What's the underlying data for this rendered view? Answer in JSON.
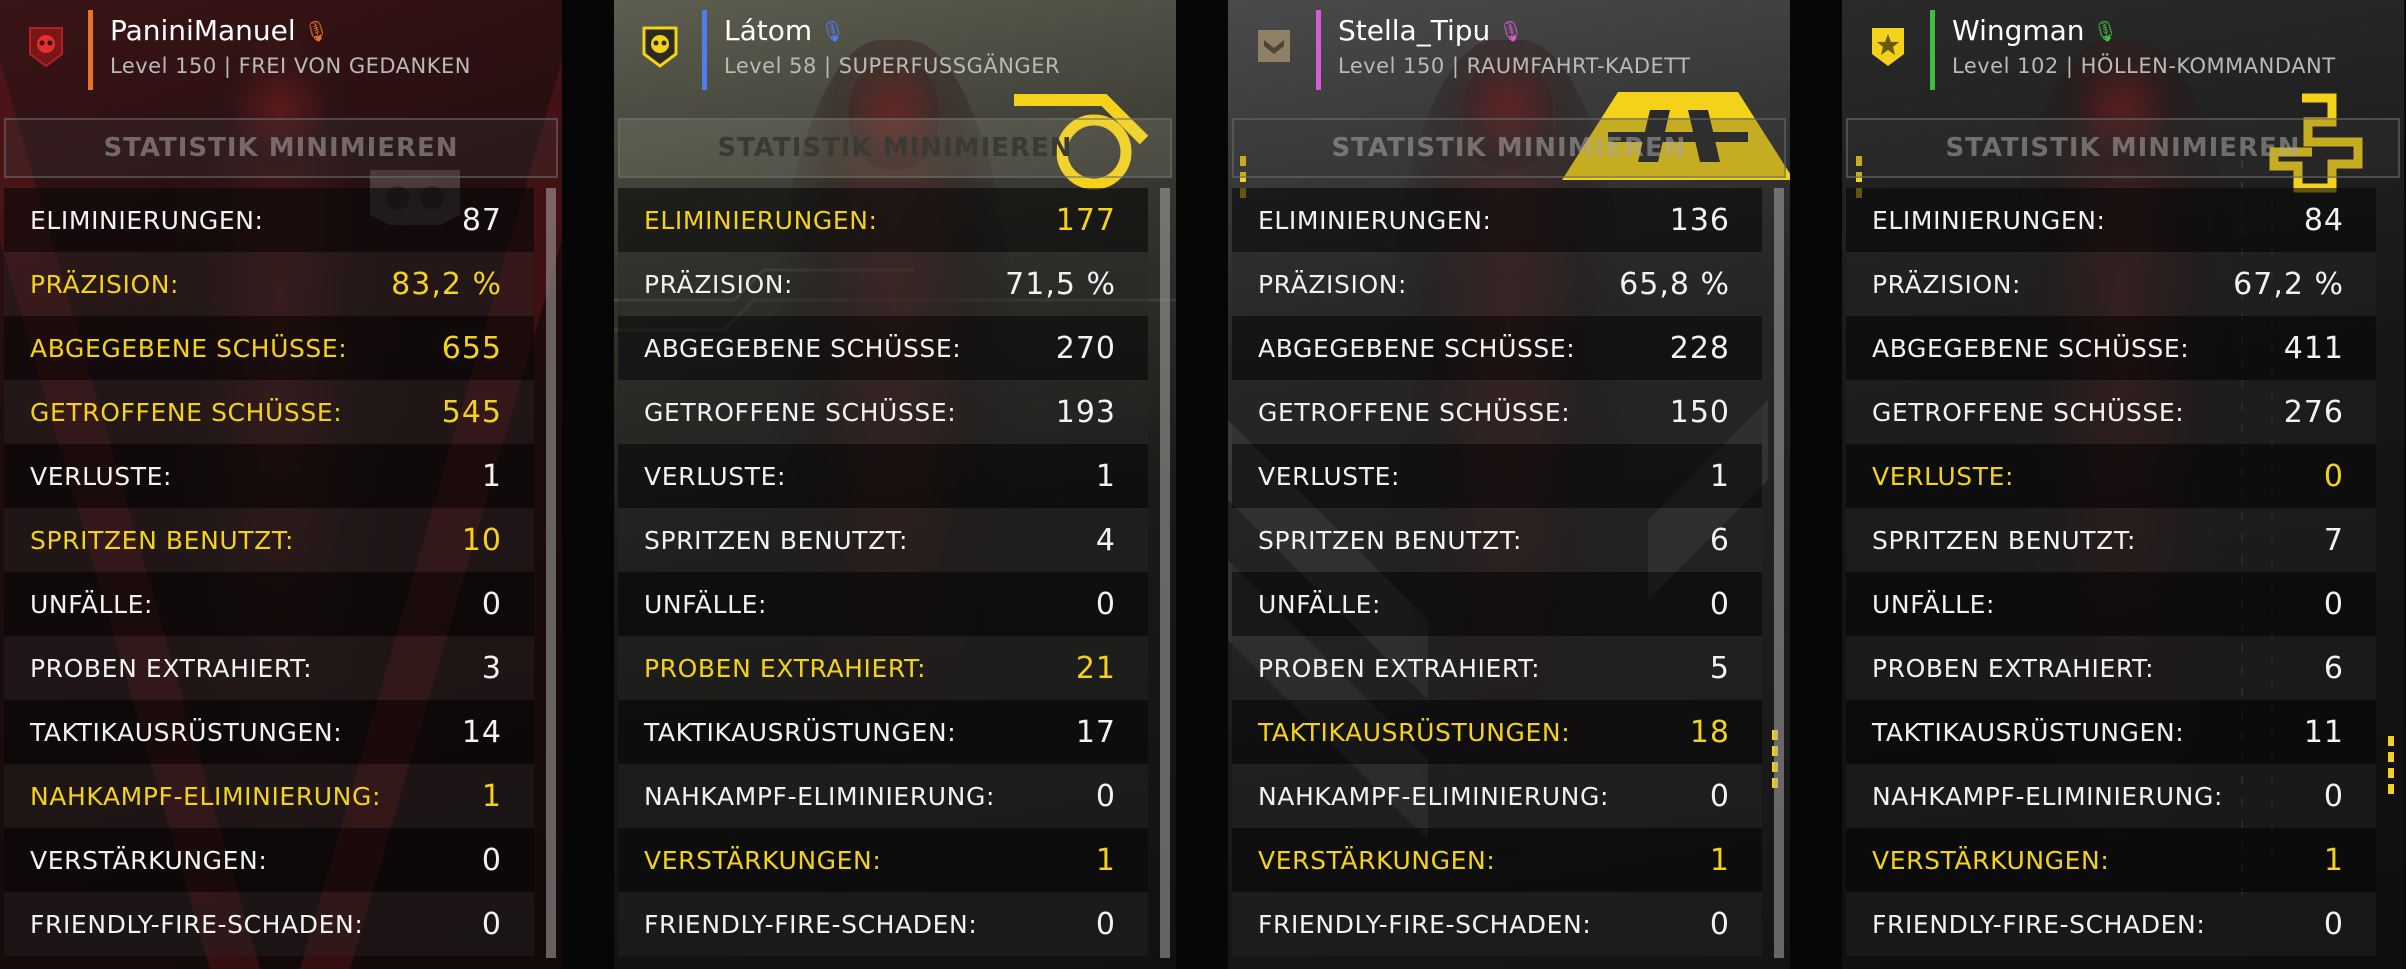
{
  "colors": {
    "highlight": "#f4d219",
    "text": "#f2f2f2",
    "muted": "#b9b9b9"
  },
  "players": [
    {
      "name": "PaniniManuel",
      "level": "Level 150 | FREI VON GEDANKEN",
      "accent_color": "#e8742a",
      "mic_color": "#e8742a",
      "emblem_icon": "skull-emblem-red",
      "minimize_label": "STATISTIK MINIMIEREN",
      "stats": [
        {
          "label": "ELIMINIERUNGEN:",
          "value": "87",
          "highlight": false
        },
        {
          "label": "PRÄZISION:",
          "value": "83,2 %",
          "highlight": true
        },
        {
          "label": "ABGEGEBENE SCHÜSSE:",
          "value": "655",
          "highlight": true
        },
        {
          "label": "GETROFFENE SCHÜSSE:",
          "value": "545",
          "highlight": true
        },
        {
          "label": "VERLUSTE:",
          "value": "1",
          "highlight": false
        },
        {
          "label": "SPRITZEN BENUTZT:",
          "value": "10",
          "highlight": true
        },
        {
          "label": "UNFÄLLE:",
          "value": "0",
          "highlight": false
        },
        {
          "label": "PROBEN EXTRAHIERT:",
          "value": "3",
          "highlight": false
        },
        {
          "label": "TAKTIKAUSRÜSTUNGEN:",
          "value": "14",
          "highlight": false
        },
        {
          "label": "NAHKAMPF-ELIMINIERUNG:",
          "value": "1",
          "highlight": true
        },
        {
          "label": "VERSTÄRKUNGEN:",
          "value": "0",
          "highlight": false
        },
        {
          "label": "FRIENDLY-FIRE-SCHADEN:",
          "value": "0",
          "highlight": false
        }
      ]
    },
    {
      "name": "Látom",
      "level": "Level 58 | SUPERFUSSGÄNGER",
      "accent_color": "#4f7df0",
      "mic_color": "#4f7df0",
      "emblem_icon": "skull-emblem-yellow",
      "minimize_label": "STATISTIK MINIMIEREN",
      "stats": [
        {
          "label": "ELIMINIERUNGEN:",
          "value": "177",
          "highlight": true
        },
        {
          "label": "PRÄZISION:",
          "value": "71,5 %",
          "highlight": false
        },
        {
          "label": "ABGEGEBENE SCHÜSSE:",
          "value": "270",
          "highlight": false
        },
        {
          "label": "GETROFFENE SCHÜSSE:",
          "value": "193",
          "highlight": false
        },
        {
          "label": "VERLUSTE:",
          "value": "1",
          "highlight": false
        },
        {
          "label": "SPRITZEN BENUTZT:",
          "value": "4",
          "highlight": false
        },
        {
          "label": "UNFÄLLE:",
          "value": "0",
          "highlight": false
        },
        {
          "label": "PROBEN EXTRAHIERT:",
          "value": "21",
          "highlight": true
        },
        {
          "label": "TAKTIKAUSRÜSTUNGEN:",
          "value": "17",
          "highlight": false
        },
        {
          "label": "NAHKAMPF-ELIMINIERUNG:",
          "value": "0",
          "highlight": false
        },
        {
          "label": "VERSTÄRKUNGEN:",
          "value": "1",
          "highlight": true
        },
        {
          "label": "FRIENDLY-FIRE-SCHADEN:",
          "value": "0",
          "highlight": false
        }
      ]
    },
    {
      "name": "Stella_Tipu",
      "level": "Level 150 | RAUMFAHRT-KADETT",
      "accent_color": "#d45cd4",
      "mic_color": "#d45cd4",
      "emblem_icon": "chevron-emblem-tan",
      "minimize_label": "STATISTIK MINIMIEREN",
      "stats": [
        {
          "label": "ELIMINIERUNGEN:",
          "value": "136",
          "highlight": false
        },
        {
          "label": "PRÄZISION:",
          "value": "65,8 %",
          "highlight": false
        },
        {
          "label": "ABGEGEBENE SCHÜSSE:",
          "value": "228",
          "highlight": false
        },
        {
          "label": "GETROFFENE SCHÜSSE:",
          "value": "150",
          "highlight": false
        },
        {
          "label": "VERLUSTE:",
          "value": "1",
          "highlight": false
        },
        {
          "label": "SPRITZEN BENUTZT:",
          "value": "6",
          "highlight": false
        },
        {
          "label": "UNFÄLLE:",
          "value": "0",
          "highlight": false
        },
        {
          "label": "PROBEN EXTRAHIERT:",
          "value": "5",
          "highlight": false
        },
        {
          "label": "TAKTIKAUSRÜSTUNGEN:",
          "value": "18",
          "highlight": true
        },
        {
          "label": "NAHKAMPF-ELIMINIERUNG:",
          "value": "0",
          "highlight": false
        },
        {
          "label": "VERSTÄRKUNGEN:",
          "value": "1",
          "highlight": true
        },
        {
          "label": "FRIENDLY-FIRE-SCHADEN:",
          "value": "0",
          "highlight": false
        }
      ]
    },
    {
      "name": "Wingman",
      "level": "Level 102 | HÖLLEN-KOMMANDANT",
      "accent_color": "#3fbf3f",
      "mic_color": "#3fbf3f",
      "emblem_icon": "star-emblem-yellow",
      "minimize_label": "STATISTIK MINIMIEREN",
      "stats": [
        {
          "label": "ELIMINIERUNGEN:",
          "value": "84",
          "highlight": false
        },
        {
          "label": "PRÄZISION:",
          "value": "67,2 %",
          "highlight": false
        },
        {
          "label": "ABGEGEBENE SCHÜSSE:",
          "value": "411",
          "highlight": false
        },
        {
          "label": "GETROFFENE SCHÜSSE:",
          "value": "276",
          "highlight": false
        },
        {
          "label": "VERLUSTE:",
          "value": "0",
          "highlight": true
        },
        {
          "label": "SPRITZEN BENUTZT:",
          "value": "7",
          "highlight": false
        },
        {
          "label": "UNFÄLLE:",
          "value": "0",
          "highlight": false
        },
        {
          "label": "PROBEN EXTRAHIERT:",
          "value": "6",
          "highlight": false
        },
        {
          "label": "TAKTIKAUSRÜSTUNGEN:",
          "value": "11",
          "highlight": false
        },
        {
          "label": "NAHKAMPF-ELIMINIERUNG:",
          "value": "0",
          "highlight": false
        },
        {
          "label": "VERSTÄRKUNGEN:",
          "value": "1",
          "highlight": true
        },
        {
          "label": "FRIENDLY-FIRE-SCHADEN:",
          "value": "0",
          "highlight": false
        }
      ]
    }
  ]
}
